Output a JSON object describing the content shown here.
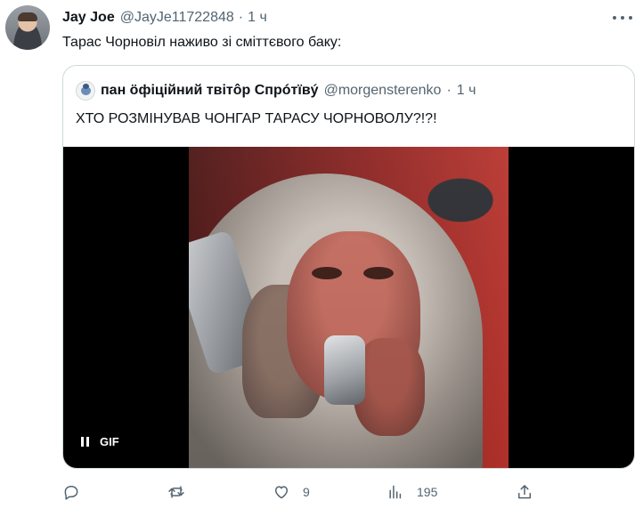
{
  "author": {
    "name": "Jay Joe",
    "handle": "@JayJe11722848",
    "separator": "·",
    "time": "1 ч"
  },
  "tweet": {
    "text": "Тарас Чорновіл наживо зі сміттєвого баку:"
  },
  "quote": {
    "name": "пан ӧфіційний твітôр Спрóтївý",
    "handle": "@morgensterenko",
    "separator": "·",
    "time": "1 ч",
    "text": "ХТО РОЗМІНУВАВ ЧОНГАР ТАРАСУ ЧОРНОВОЛУ?!?!",
    "media": {
      "type_label": "GIF",
      "controls_icon": "pause-icon"
    }
  },
  "actions": {
    "reply": {
      "icon": "reply-icon",
      "count": ""
    },
    "retweet": {
      "icon": "retweet-icon",
      "count": ""
    },
    "like": {
      "icon": "like-icon",
      "count": "9"
    },
    "views": {
      "icon": "views-icon",
      "count": "195"
    },
    "share": {
      "icon": "share-icon"
    }
  },
  "colors": {
    "text_primary": "#0f1419",
    "text_secondary": "#536471",
    "border": "#cfd9de"
  }
}
